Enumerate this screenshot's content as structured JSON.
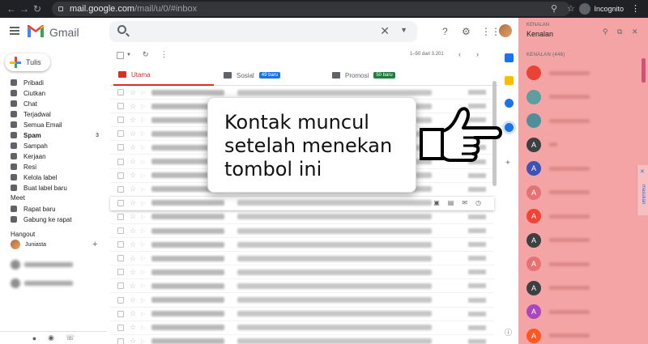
{
  "browser": {
    "url_host": "mail.google.com",
    "url_path": "/mail/u/0/#inbox",
    "incognito_label": "Incognito"
  },
  "header": {
    "app_name": "Gmail",
    "search_placeholder": ""
  },
  "sidebar": {
    "compose_label": "Tulis",
    "items": [
      {
        "label": "Pribadi",
        "count": "",
        "bold": false
      },
      {
        "label": "Ciutkan",
        "count": "",
        "bold": false
      },
      {
        "label": "Chat",
        "count": "",
        "bold": false
      },
      {
        "label": "Terjadwal",
        "count": "",
        "bold": false
      },
      {
        "label": "Semua Email",
        "count": "",
        "bold": false
      },
      {
        "label": "Spam",
        "count": "3",
        "bold": true
      },
      {
        "label": "Sampah",
        "count": "",
        "bold": false
      },
      {
        "label": "Kerjaan",
        "count": "",
        "bold": false
      },
      {
        "label": "Resi",
        "count": "",
        "bold": false
      },
      {
        "label": "Kelola label",
        "count": "",
        "bold": false
      },
      {
        "label": "Buat label baru",
        "count": "",
        "bold": false
      }
    ],
    "meet_title": "Meet",
    "meet_items": [
      "Rapat baru",
      "Gabung ke rapat"
    ],
    "hangout_title": "Hangout",
    "hangout_user": "Juniasta"
  },
  "toolbar": {
    "pager_text": "1–50 dari 3.201"
  },
  "tabs": [
    {
      "label": "Utama",
      "badge": "",
      "badge_color": ""
    },
    {
      "label": "Sosial",
      "badge": "49 baru",
      "badge_color": "#1a73e8"
    },
    {
      "label": "Promosi",
      "badge": "50 baru",
      "badge_color": "#188038"
    }
  ],
  "contacts": {
    "title_small": "KENALAN",
    "title": "Kenalan",
    "count_label": "KENALAN (446)",
    "list": [
      {
        "initial": "",
        "color": "#ea4335"
      },
      {
        "initial": "",
        "color": "#5f9ea0"
      },
      {
        "initial": "",
        "color": "#4f8f9a"
      },
      {
        "initial": "A",
        "color": "#3c4043"
      },
      {
        "initial": "A",
        "color": "#3f51b5"
      },
      {
        "initial": "A",
        "color": "#e57373"
      },
      {
        "initial": "A",
        "color": "#f44336"
      },
      {
        "initial": "A",
        "color": "#3c4043"
      },
      {
        "initial": "A",
        "color": "#e57373"
      },
      {
        "initial": "A",
        "color": "#3c4043"
      },
      {
        "initial": "A",
        "color": "#ab47bc"
      },
      {
        "initial": "A",
        "color": "#ff5722"
      }
    ],
    "hide_label": "masukan"
  },
  "callout": {
    "text": "Kontak muncul setelah menekan tombol ini"
  }
}
